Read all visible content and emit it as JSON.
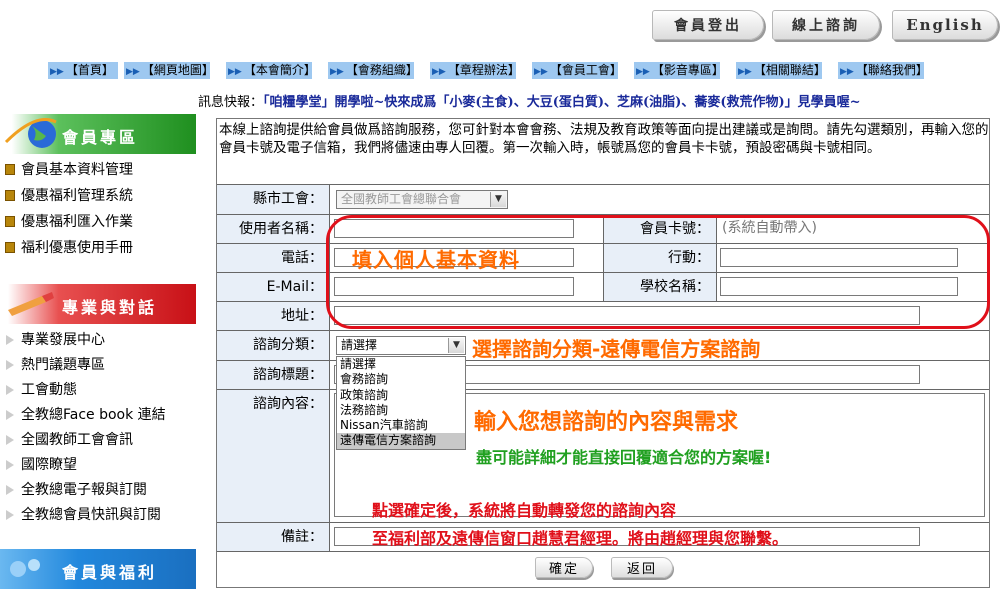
{
  "top_buttons": {
    "logout": "會員登出",
    "inquiry": "線上諮詢",
    "english": "English"
  },
  "nav": [
    "【首頁】",
    "【網頁地圖】",
    "【本會簡介】",
    "【會務組織】",
    "【章程辦法】",
    "【會員工會】",
    "【影音專區】",
    "【相關聯結】",
    "【聯絡我們】"
  ],
  "news": {
    "label": "訊息快報：",
    "text": "「咱糧學堂」開學啦~快來成爲「小麥(主食)、大豆(蛋白質)、芝麻(油脂)、蕎麥(救荒作物)」見學員喔~"
  },
  "sidebar": {
    "member": {
      "title": "會員專區",
      "items": [
        "會員基本資料管理",
        "優惠福利管理系統",
        "優惠福利匯入作業",
        "福利優惠使用手冊"
      ]
    },
    "pro": {
      "title": "專業與對話",
      "items": [
        "專業發展中心",
        "熱門議題專區",
        "工會動態",
        "全教總Face book 連結",
        "全國教師工會會訊",
        "國際瞭望",
        "全教總電子報與訂閱",
        "全教總會員快訊與訂閱"
      ]
    },
    "welfare": {
      "title": "會員與福利"
    }
  },
  "form": {
    "intro": "本線上諮詢提供給會員做爲諮詢服務，您可針對本會會務、法規及教育政策等面向提出建議或是詢問。請先勾選類別，再輸入您的會員卡號及電子信箱，我們將儘速由專人回覆。第一次輸入時，帳號爲您的會員卡卡號，預設密碼與卡號相同。",
    "union_label": "縣市工會：",
    "union_value": "全國教師工會總聯合會",
    "username_label": "使用者名稱：",
    "card_label": "會員卡號：",
    "card_value": "(系統自動帶入)",
    "phone_label": "電話：",
    "mobile_label": "行動：",
    "email_label": "E-Mail：",
    "school_label": "學校名稱：",
    "address_label": "地址：",
    "category_label": "諮詢分類：",
    "category_value": "請選擇",
    "category_options": [
      "請選擇",
      "會務諮詢",
      "政策諮詢",
      "法務諮詢",
      "Nissan汽車諮詢",
      "遠傳電信方案諮詢"
    ],
    "title_label": "諮詢標題：",
    "content_label": "諮詢內容：",
    "note_label": "備註：",
    "confirm": "確定",
    "back": "返回"
  },
  "annotations": {
    "personal": "填入個人基本資料",
    "category": "選擇諮詢分類-遠傳電信方案諮詢",
    "content": "輸入您想諮詢的內容與需求",
    "content_sub": "盡可能詳細才能直接回覆適合您的方案喔!",
    "after1": "點選確定後，系統將自動轉發您的諮詢內容",
    "after2": "至福利部及遠傳信窗口趙慧君經理。將由趙經理與您聯繫。"
  },
  "colors": {
    "member_head": "#2a9a2a",
    "pro_head": "#d8141a",
    "welfare_head": "#2288dd",
    "nav_bg": "#9ec8f0",
    "annotation_orange": "#ff6a00",
    "annotation_red": "#e0101a",
    "annotation_green": "#20a020"
  }
}
